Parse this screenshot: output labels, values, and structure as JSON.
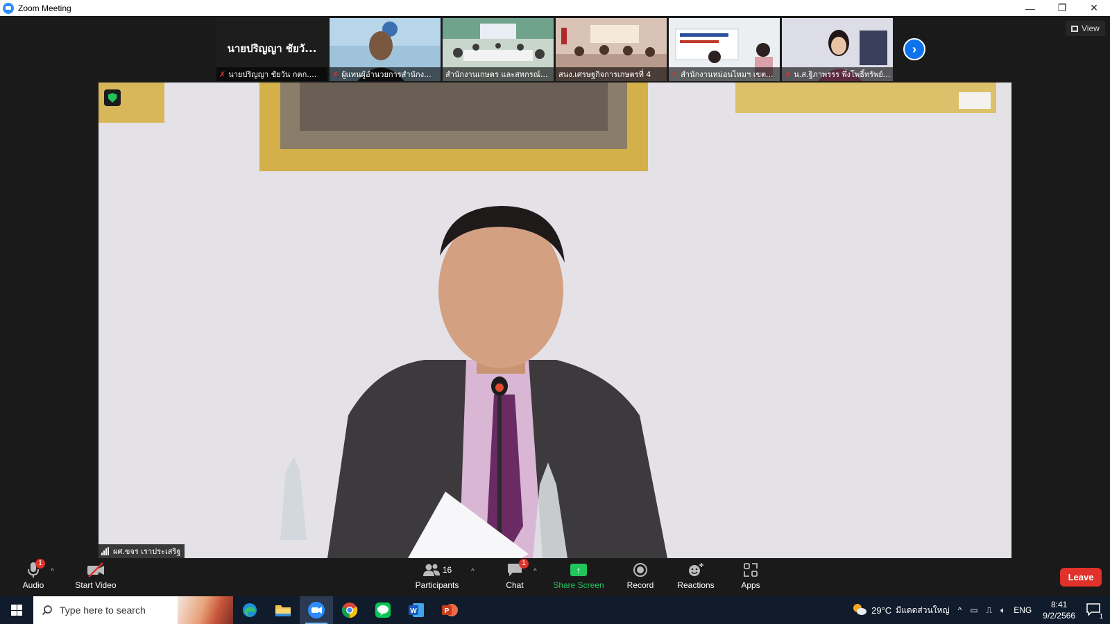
{
  "window": {
    "title": "Zoom Meeting",
    "controls": {
      "minimize": "—",
      "restore": "❐",
      "close": "✕"
    }
  },
  "gallery_strip": {
    "tiles": [
      {
        "big_name": "นายปริญญา ชัยวั...",
        "caption": "นายปริญญา ชัยวัน กตก....",
        "muted": true
      },
      {
        "caption": "ผู้แทนผู้อำนวยการสำนักง...",
        "muted": true
      },
      {
        "caption": "สำนักงานเกษตร และสหกรณ์...",
        "muted": false
      },
      {
        "caption": "สนง.เศรษฐกิจการเกษตรที่ 4",
        "muted": false
      },
      {
        "caption": "สำนักงานหม่อนไหมฯ เขต...",
        "muted": true
      },
      {
        "caption": "น.ส.ฐิภาพรรร พึ่งโพธิ์ทรัพย์...",
        "muted": true
      }
    ],
    "view_label": "View"
  },
  "speaker": {
    "name": "ผศ.ขจร เราประเสริฐ"
  },
  "toolbar": {
    "audio": {
      "label": "Audio",
      "badge": "1"
    },
    "video": {
      "label": "Start Video"
    },
    "participants": {
      "label": "Participants",
      "count": "16"
    },
    "chat": {
      "label": "Chat",
      "badge": "1"
    },
    "share": {
      "label": "Share Screen"
    },
    "record": {
      "label": "Record"
    },
    "reactions": {
      "label": "Reactions"
    },
    "apps": {
      "label": "Apps"
    },
    "leave": {
      "label": "Leave"
    }
  },
  "taskbar": {
    "search_placeholder": "Type here to search",
    "apps": [
      "edge-icon",
      "file-explorer-icon",
      "zoom-icon",
      "chrome-icon",
      "line-icon",
      "word-icon",
      "powerpoint-icon"
    ],
    "weather": {
      "temp": "29°C",
      "desc": "มีแดดส่วนใหญ่"
    },
    "language": "ENG",
    "time": "8:41",
    "date": "9/2/2566",
    "notifications": "1"
  },
  "colors": {
    "accent_blue": "#0e72ed",
    "leave_red": "#e0312b",
    "share_green": "#22c55e",
    "taskbar": "#101c2c"
  }
}
